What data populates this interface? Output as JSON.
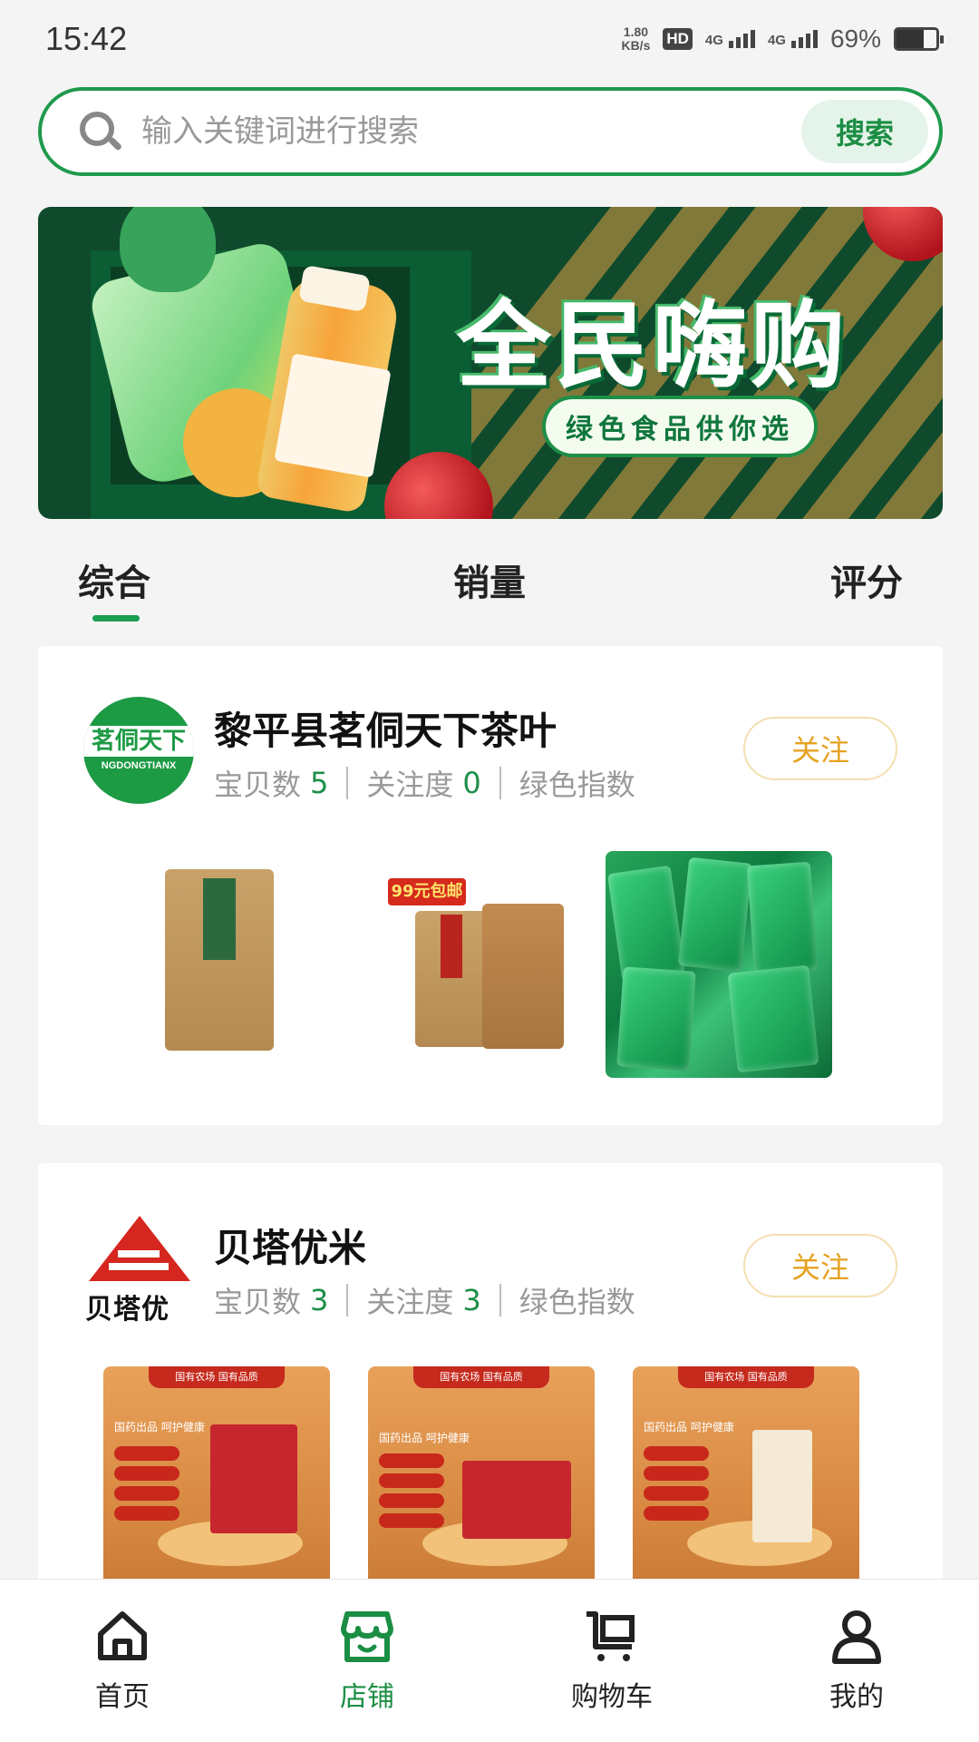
{
  "status_bar": {
    "time": "15:42",
    "net_speed_value": "1.80",
    "net_speed_unit": "KB/s",
    "hd_label": "HD",
    "sim1": "4G",
    "sim2": "4G",
    "battery_percent": "69%",
    "battery_level": 0.69
  },
  "search": {
    "placeholder": "输入关键词进行搜索",
    "button_label": "搜索",
    "accent_color": "#1f9a4c"
  },
  "banner": {
    "title": "全民嗨购",
    "subtitle": "绿色食品供你选"
  },
  "tabs": [
    {
      "label": "综合",
      "active": true
    },
    {
      "label": "销量",
      "active": false
    },
    {
      "label": "评分",
      "active": false
    }
  ],
  "stores": [
    {
      "name": "黎平县茗侗天下茶叶",
      "logo_text": "茗侗天下",
      "logo_subtext": "NGDONGTIANX",
      "items_label": "宝贝数",
      "items_count": "5",
      "follow_label": "关注度",
      "follow_count": "0",
      "green_index_label": "绿色指数",
      "follow_button": "关注",
      "promo_badge": "99元包邮"
    },
    {
      "name": "贝塔优米",
      "logo_text": "贝塔优",
      "items_label": "宝贝数",
      "items_count": "3",
      "follow_label": "关注度",
      "follow_count": "3",
      "green_index_label": "绿色指数",
      "follow_button": "关注",
      "product_header": "国有农场 国有品质",
      "product_slogan": "国药出品 呵护健康"
    }
  ],
  "bottom_nav": [
    {
      "label": "首页",
      "icon": "home-icon",
      "active": false
    },
    {
      "label": "店铺",
      "icon": "store-icon",
      "active": true
    },
    {
      "label": "购物车",
      "icon": "cart-icon",
      "active": false
    },
    {
      "label": "我的",
      "icon": "user-icon",
      "active": false
    }
  ]
}
